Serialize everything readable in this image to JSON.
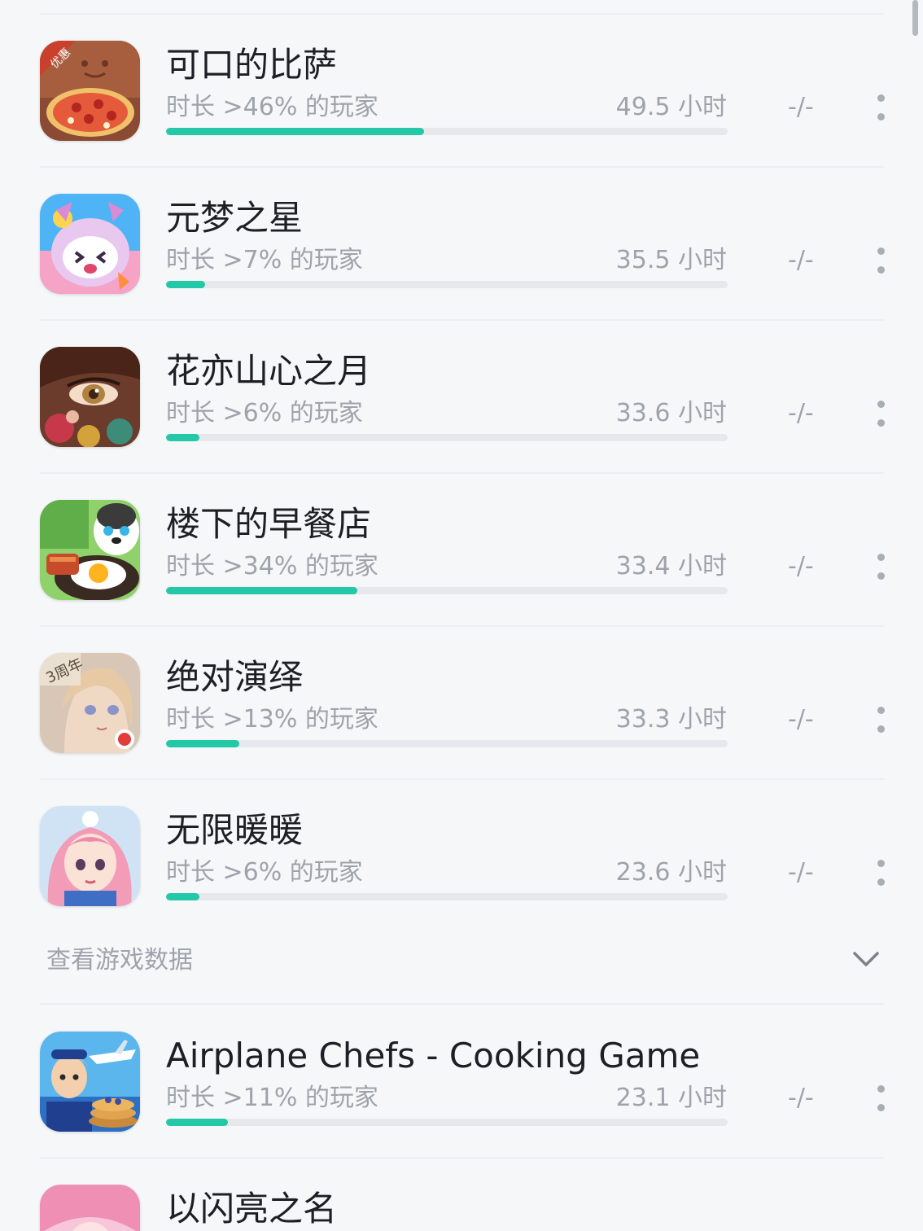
{
  "games": [
    {
      "title": "可口的比萨",
      "subtitle": "时长 >46% 的玩家",
      "hours": "49.5 小时",
      "rank": "-/-",
      "percentile": 0.46,
      "icon": "pizza-game-icon"
    },
    {
      "title": "元梦之星",
      "subtitle": "时长 >7% 的玩家",
      "hours": "35.5 小时",
      "rank": "-/-",
      "percentile": 0.07,
      "icon": "yuanmeng-game-icon"
    },
    {
      "title": "花亦山心之月",
      "subtitle": "时长 >6% 的玩家",
      "hours": "33.6 小时",
      "rank": "-/-",
      "percentile": 0.06,
      "icon": "huayi-game-icon"
    },
    {
      "title": "楼下的早餐店",
      "subtitle": "时长 >34% 的玩家",
      "hours": "33.4 小时",
      "rank": "-/-",
      "percentile": 0.34,
      "icon": "breakfast-game-icon"
    },
    {
      "title": "绝对演绎",
      "subtitle": "时长 >13% 的玩家",
      "hours": "33.3 小时",
      "rank": "-/-",
      "percentile": 0.13,
      "icon": "juedui-game-icon"
    },
    {
      "title": "无限暖暖",
      "subtitle": "时长 >6% 的玩家",
      "hours": "23.6 小时",
      "rank": "-/-",
      "percentile": 0.06,
      "icon": "nuannuan-game-icon"
    },
    {
      "title": "Airplane Chefs - Cooking Game",
      "subtitle": "时长 >11% 的玩家",
      "hours": "23.1 小时",
      "rank": "-/-",
      "percentile": 0.11,
      "icon": "airplane-chefs-game-icon"
    },
    {
      "title": "以闪亮之名",
      "subtitle": "",
      "hours": "",
      "rank": "",
      "percentile": null,
      "icon": "shining-game-icon"
    }
  ],
  "section": {
    "label": "查看游戏数据",
    "icon": "chevron-down-icon"
  },
  "colors": {
    "accent": "#23c9a6",
    "track": "#e6e8eb",
    "title": "#1d1f24",
    "muted": "#9ea3ab"
  }
}
